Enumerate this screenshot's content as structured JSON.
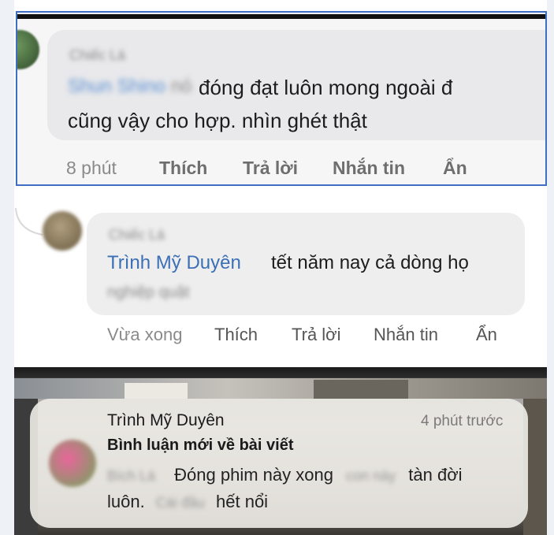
{
  "comment1": {
    "author": "Chiếc Lá",
    "mention": "Shun Shino",
    "mention_suffix": "nó",
    "text_line1": "đóng đạt luôn mong ngoài đ",
    "text_line2": "cũng vậy cho hợp. nhìn ghét thật",
    "time": "8 phút",
    "like": "Thích",
    "reply": "Trả lời",
    "message": "Nhắn tin",
    "hide": "Ẩn"
  },
  "comment2": {
    "author": "Chiếc Lá",
    "mention": "Trình Mỹ Duyên",
    "text_line1": "tết năm nay cả dòng họ",
    "text_line2": "nghiệp quật",
    "time": "Vừa xong",
    "like": "Thích",
    "reply": "Trả lời",
    "message": "Nhắn tin",
    "hide": "Ẩn"
  },
  "notification": {
    "sender": "Trình Mỹ Duyên",
    "time": "4 phút trước",
    "subtitle": "Bình luận mới về bài viết",
    "blur_name": "Bích Lá",
    "body_part1": "Đóng phim này xong",
    "blur_mid": "con này",
    "body_part2": "tàn đời",
    "body_part3": "luôn.",
    "blur_mid2": "Cái đầu",
    "body_part4": "hết nổi"
  },
  "colors": {
    "highlight_border": "#3f6fc4",
    "mention_blue": "#3b6fb6",
    "bubble_gray": "#e9e9eb"
  }
}
